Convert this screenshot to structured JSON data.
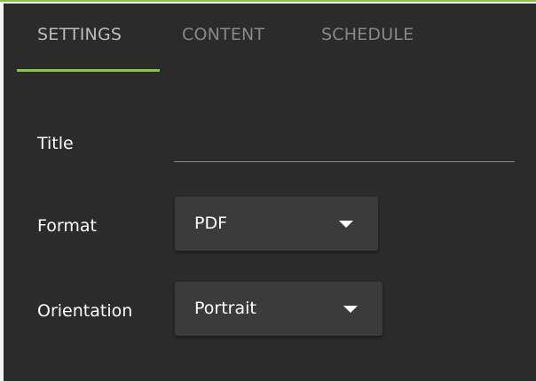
{
  "tabs": {
    "settings": "SETTINGS",
    "content": "CONTENT",
    "schedule": "SCHEDULE",
    "active": "SETTINGS"
  },
  "form": {
    "title_label": "Title",
    "title_value": "",
    "format_label": "Format",
    "format_value": "PDF",
    "orientation_label": "Orientation",
    "orientation_value": "Portrait"
  },
  "colors": {
    "accent": "#8bc34a",
    "panel_background": "#2b2b2b",
    "select_background": "#3b3b3b",
    "inactive_tab_text": "#888888"
  },
  "icons": {
    "dropdown": "chevron-down-icon"
  }
}
